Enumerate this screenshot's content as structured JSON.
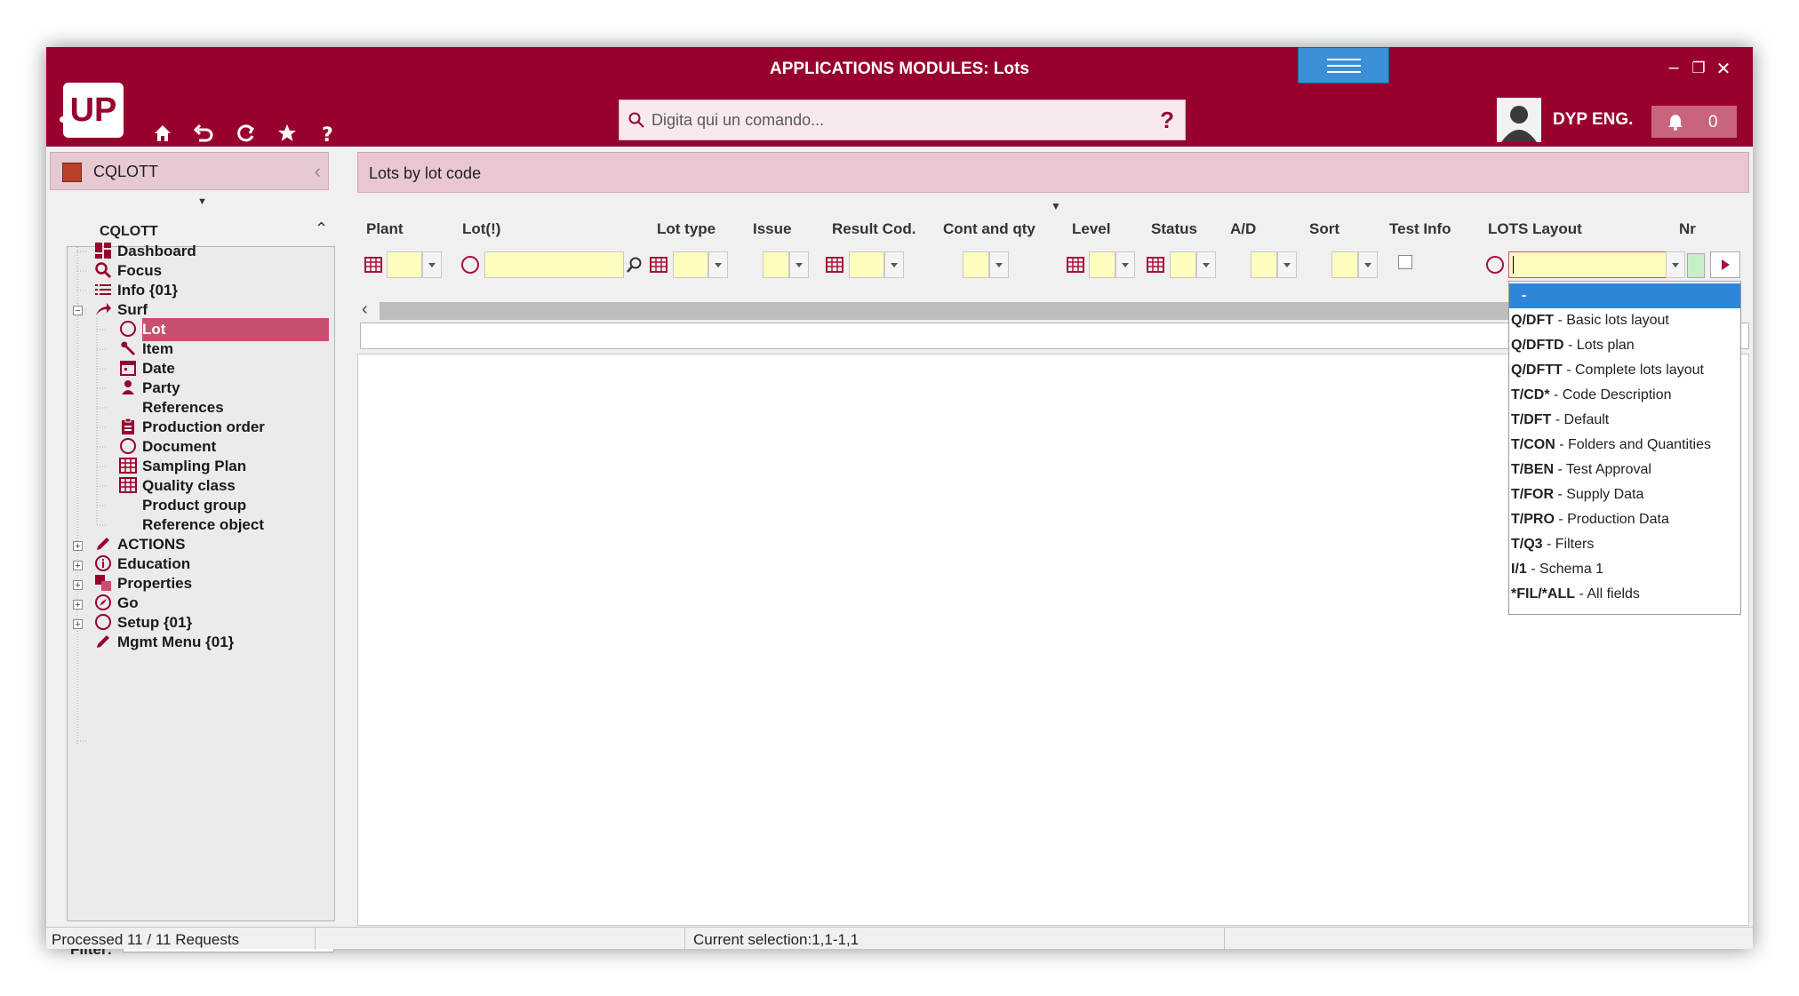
{
  "window": {
    "title": "APPLICATIONS MODULES: Lots"
  },
  "logo": "UP",
  "search": {
    "placeholder": "Digita qui un comando...",
    "help": "?"
  },
  "user": {
    "name": "DYP ENG."
  },
  "notifications": {
    "count": "0"
  },
  "left": {
    "header": "CQLOTT",
    "tree_title": "CQLOTT",
    "items": [
      {
        "label": "Dashboard",
        "icon": "dashboard-icon"
      },
      {
        "label": "Focus",
        "icon": "magnifier-icon"
      },
      {
        "label": "Info {01}",
        "icon": "list-icon"
      },
      {
        "label": "Surf",
        "icon": "arrow-icon"
      },
      {
        "label": "Lot",
        "icon": "circle-icon"
      },
      {
        "label": "Item",
        "icon": "wrench-icon"
      },
      {
        "label": "Date",
        "icon": "calendar-icon"
      },
      {
        "label": "Party",
        "icon": "person-icon"
      },
      {
        "label": "References",
        "icon": ""
      },
      {
        "label": "Production order",
        "icon": "clipboard-icon"
      },
      {
        "label": "Document",
        "icon": "circle-icon"
      },
      {
        "label": "Sampling Plan",
        "icon": "grid-icon"
      },
      {
        "label": "Quality class",
        "icon": "grid-icon"
      },
      {
        "label": "Product group",
        "icon": ""
      },
      {
        "label": "Reference object",
        "icon": ""
      },
      {
        "label": "ACTIONS",
        "icon": "pencil-icon"
      },
      {
        "label": "Education",
        "icon": "info-icon"
      },
      {
        "label": "Properties",
        "icon": "squares-icon"
      },
      {
        "label": "Go",
        "icon": "compass-icon"
      },
      {
        "label": "Setup {01}",
        "icon": "circle-icon"
      },
      {
        "label": "Mgmt Menu {01}",
        "icon": "pencil-icon"
      }
    ],
    "filter_label": "Filter:"
  },
  "main": {
    "header": "Lots by lot code",
    "columns": [
      "Plant",
      "Lot(!)",
      "Lot type",
      "Issue",
      "Result Cod.",
      "Cont and qty",
      "Level",
      "Status",
      "A/D",
      "Sort",
      "Test Info",
      "LOTS Layout",
      "Nr"
    ]
  },
  "dropdown": {
    "options": [
      {
        "code": "-",
        "desc": ""
      },
      {
        "code": "Q/DFT",
        "desc": " - Basic lots layout"
      },
      {
        "code": "Q/DFTD",
        "desc": " - Lots plan"
      },
      {
        "code": "Q/DFTT",
        "desc": " - Complete lots layout"
      },
      {
        "code": "T/CD*",
        "desc": " - Code Description"
      },
      {
        "code": "T/DFT",
        "desc": " - Default"
      },
      {
        "code": "T/CON",
        "desc": " - Folders and Quantities"
      },
      {
        "code": "T/BEN",
        "desc": " - Test Approval"
      },
      {
        "code": "T/FOR",
        "desc": " - Supply Data"
      },
      {
        "code": "T/PRO",
        "desc": " - Production Data"
      },
      {
        "code": "T/Q3",
        "desc": " - Filters"
      },
      {
        "code": "I/1",
        "desc": " - Schema 1"
      },
      {
        "code": "*FIL/*ALL",
        "desc": " - All fields"
      }
    ]
  },
  "status": {
    "left": "Processed 11 / 11 Requests",
    "middle": "Current selection:1,1-1,1"
  },
  "colors": {
    "brand": "#98002e",
    "selected": "#c94f6f",
    "highlight": "#2e86d8"
  }
}
